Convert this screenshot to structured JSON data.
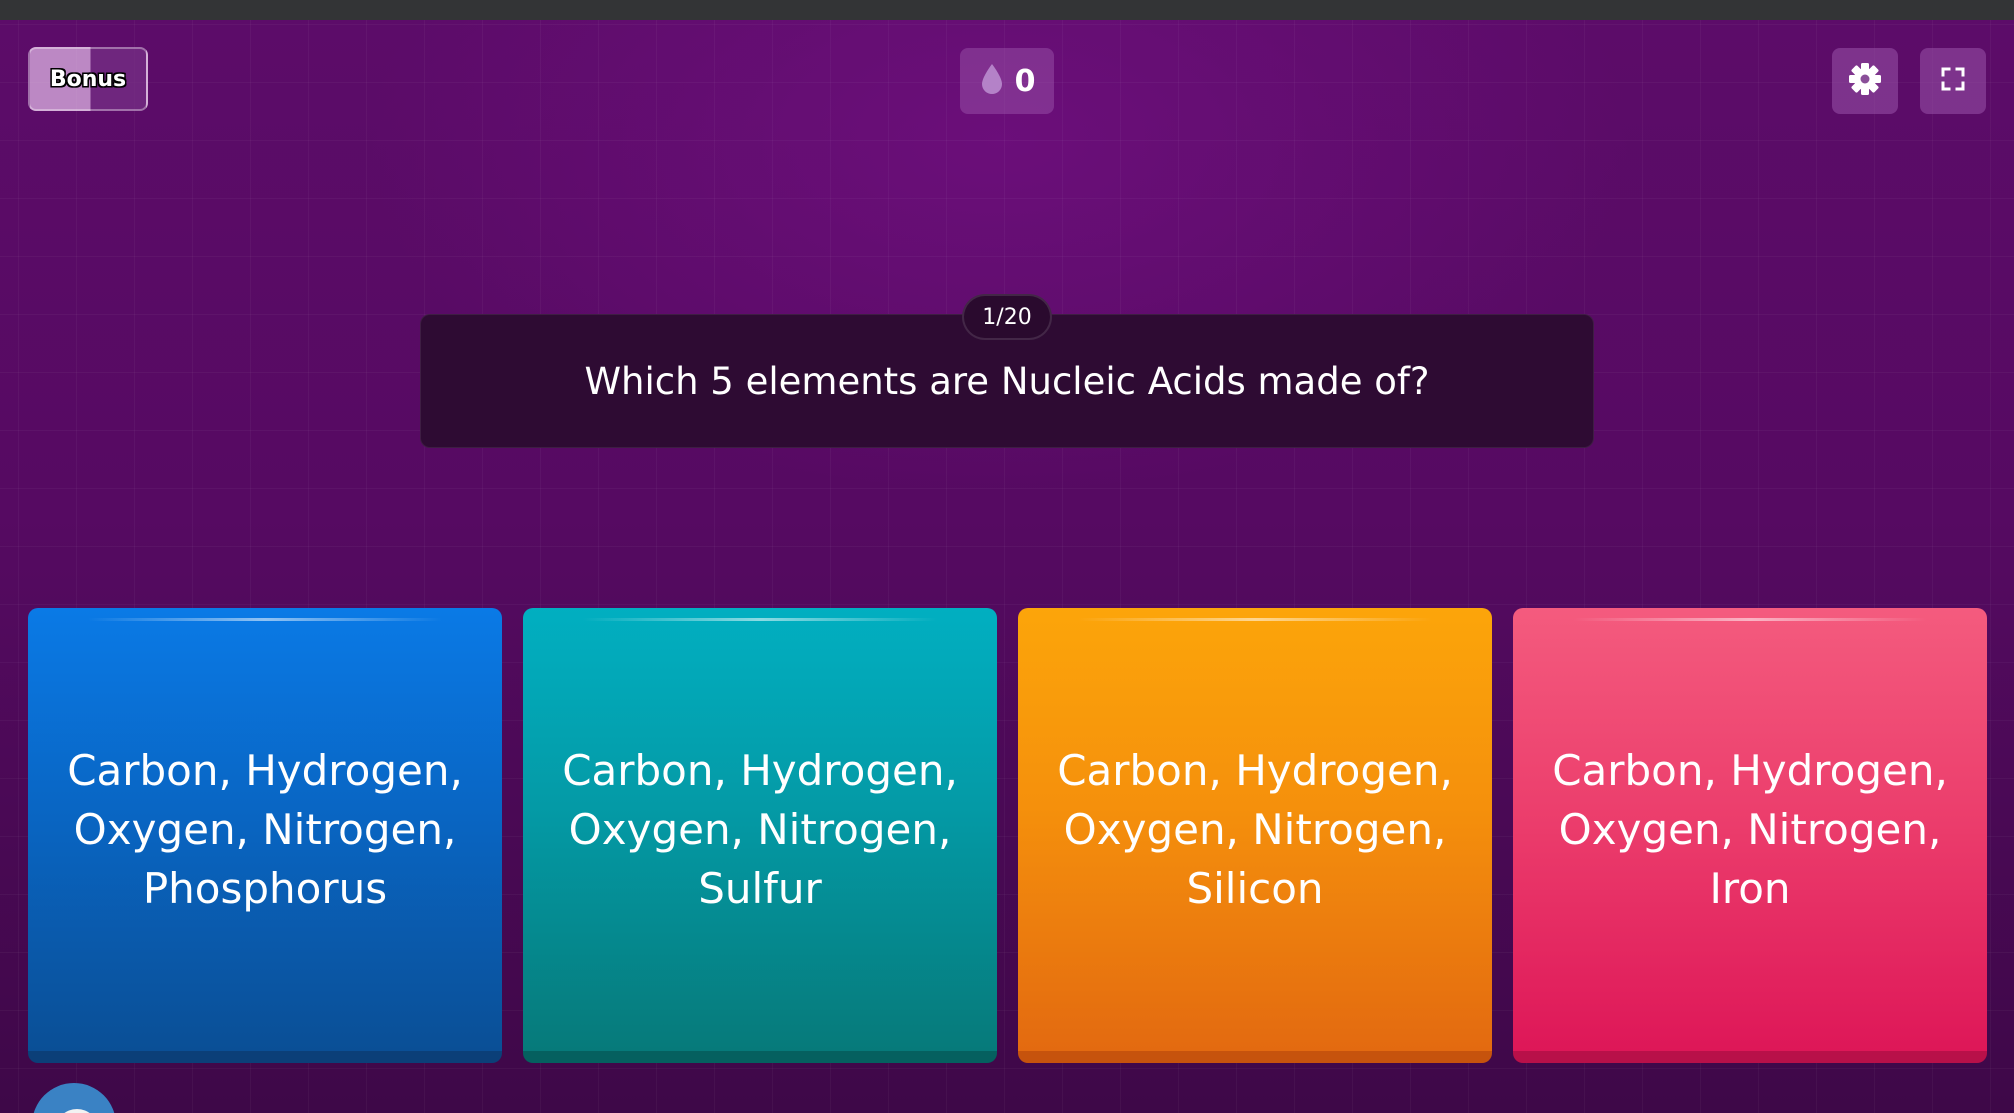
{
  "header": {
    "bonus_label": "Bonus",
    "streak_count": "0",
    "icons": {
      "streak": "drop-icon",
      "settings": "gear-icon",
      "fullscreen": "fullscreen-icon"
    }
  },
  "question": {
    "counter": "1/20",
    "text": "Which 5 elements are Nucleic Acids made of?"
  },
  "answers": [
    {
      "text": "Carbon, Hydrogen, Oxygen, Nitrogen, Phosphorus",
      "color": "#0a6fd6"
    },
    {
      "text": "Carbon, Hydrogen, Oxygen, Nitrogen, Sulfur",
      "color": "#03a4b3"
    },
    {
      "text": "Carbon, Hydrogen, Oxygen, Nitrogen, Silicon",
      "color": "#f7940c"
    },
    {
      "text": "Carbon, Hydrogen, Oxygen, Nitrogen, Iron",
      "color": "#ea3a6a"
    }
  ],
  "colors": {
    "background": "#5a0a66",
    "question_box": "#2e0b33"
  }
}
